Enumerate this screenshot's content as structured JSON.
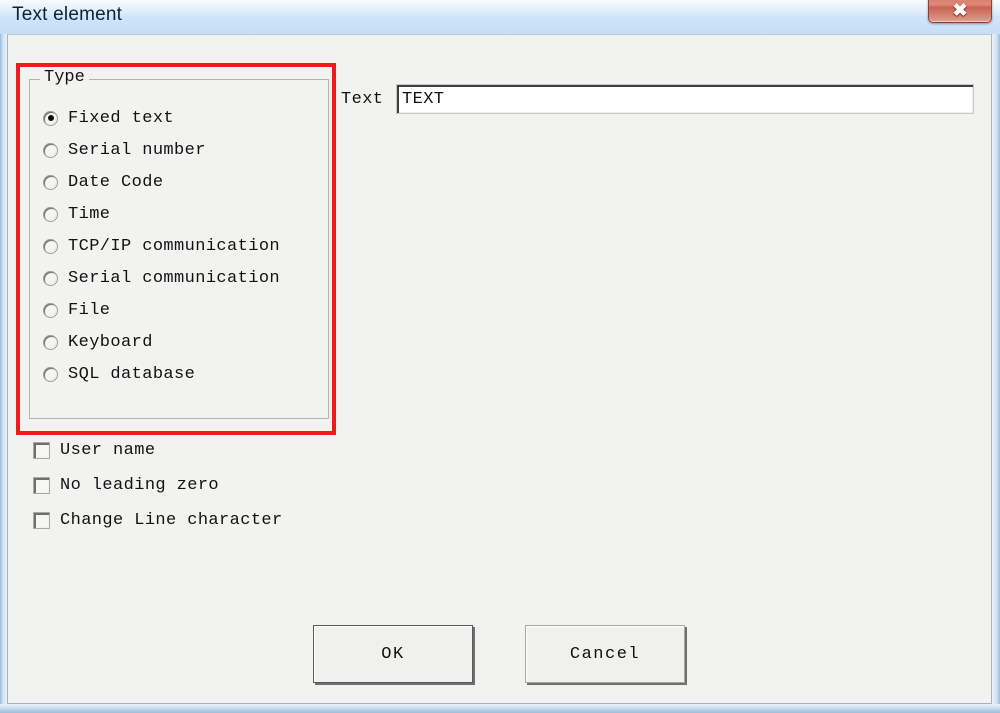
{
  "window": {
    "title": "Text element",
    "close_button": {
      "icon": "close-x-icon",
      "glyph": "✖"
    }
  },
  "type_group": {
    "legend": "Type",
    "selected_index": 0,
    "options": [
      {
        "label": "Fixed text",
        "selected": true
      },
      {
        "label": "Serial number",
        "selected": false
      },
      {
        "label": "Date Code",
        "selected": false
      },
      {
        "label": "Time",
        "selected": false
      },
      {
        "label": "TCP/IP communication",
        "selected": false
      },
      {
        "label": "Serial communication",
        "selected": false
      },
      {
        "label": "File",
        "selected": false
      },
      {
        "label": "Keyboard",
        "selected": false
      },
      {
        "label": "SQL database",
        "selected": false
      }
    ]
  },
  "checkboxes": [
    {
      "label": "User name",
      "checked": false
    },
    {
      "label": "No leading zero",
      "checked": false
    },
    {
      "label": "Change Line character",
      "checked": false
    }
  ],
  "text_field": {
    "label": "Text",
    "value": "TEXT",
    "placeholder": ""
  },
  "buttons": {
    "ok": "OK",
    "cancel": "Cancel"
  },
  "annotation": {
    "shape": "rectangle",
    "color": "#ef1c1c",
    "target": "type-group"
  },
  "colors": {
    "titlebar_top": "#dfeefb",
    "titlebar_bottom": "#c6dff7",
    "dialog_background": "#f2f2f0",
    "close_button": "#d9796a",
    "annotation_red": "#ef1c1c",
    "text_color": "#121212"
  }
}
